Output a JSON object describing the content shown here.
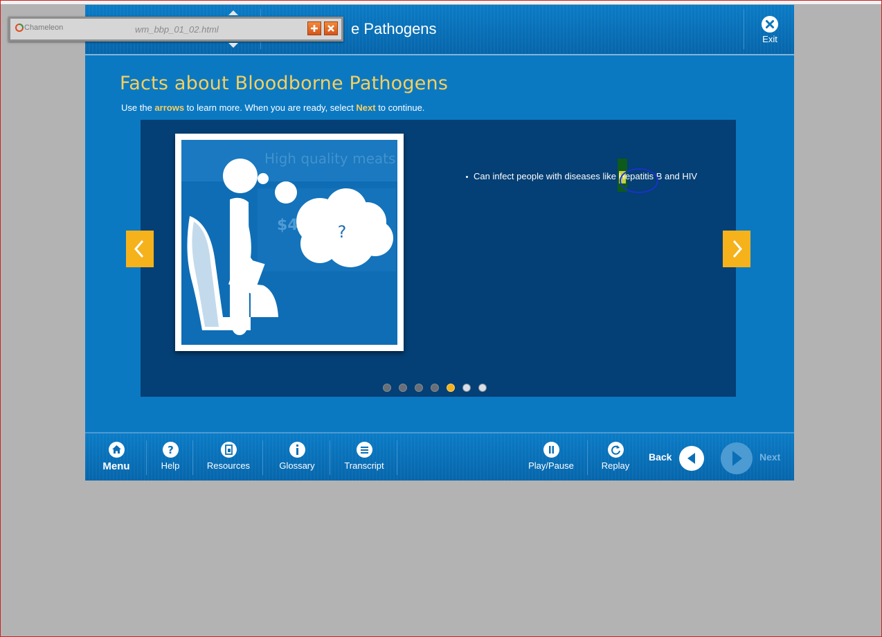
{
  "header": {
    "title": "e Pathogens",
    "exit_label": "Exit"
  },
  "content": {
    "title": "Facts about Bloodborne Pathogens",
    "instruction": {
      "part1": "Use the ",
      "arrows": "arrows",
      "part2": " to learn more.  When you are ready, select ",
      "next": "Next",
      "part3": " to continue."
    }
  },
  "slide": {
    "bullet": "Can infect people with diseases like Hepatitis B and HIV",
    "image_question_mark": "?",
    "image_background_text": "High quality meats",
    "image_price_text": "$4",
    "pagination": {
      "total": 7,
      "current": 5
    }
  },
  "footer": {
    "menu": "Menu",
    "help": "Help",
    "resources": "Resources",
    "glossary": "Glossary",
    "transcript": "Transcript",
    "play_pause": "Play/Pause",
    "replay": "Replay",
    "back": "Back",
    "next": "Next"
  },
  "chameleon_bar": {
    "logo": "Chameleon",
    "filename": "wm_bbp_01_02.html"
  },
  "colors": {
    "accent_yellow": "#f6b21b",
    "title_gold": "#f7cf5e",
    "course_blue": "#0b79c2",
    "slide_navy": "#043f75"
  },
  "icons": [
    "home-icon",
    "help-icon",
    "resources-icon",
    "glossary-icon",
    "transcript-icon",
    "play-pause-icon",
    "replay-icon",
    "back-arrow-icon",
    "next-arrow-icon",
    "exit-icon",
    "plus-icon",
    "close-icon"
  ]
}
